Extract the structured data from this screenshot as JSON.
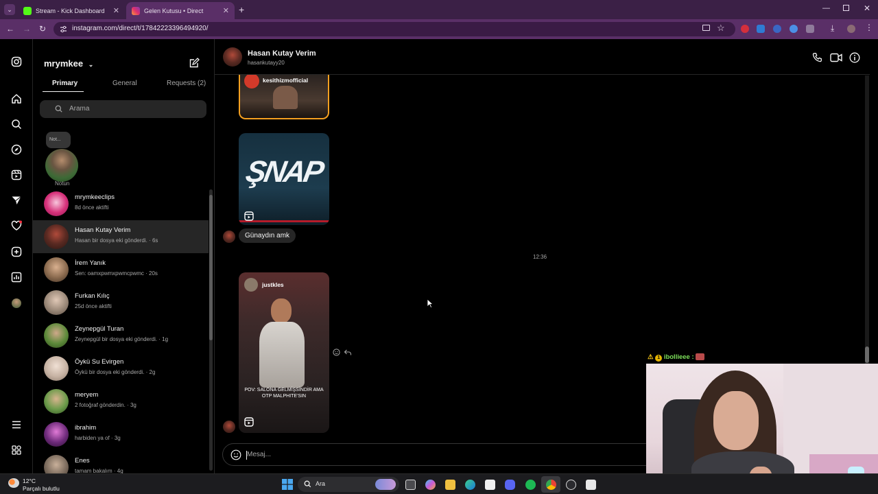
{
  "browser": {
    "tabs": [
      {
        "title": "Stream - Kick Dashboard",
        "active": false,
        "favicon_color": "#53fc18"
      },
      {
        "title": "Gelen Kutusu • Direct",
        "active": true,
        "favicon_color": "#e1306c"
      }
    ],
    "url": "instagram.com/direct/t/17842223396494920/"
  },
  "sidebar": {
    "account_name": "mrymkee",
    "tabs": [
      "Primary",
      "General",
      "Requests (2)"
    ],
    "search_placeholder": "Arama",
    "note": {
      "bubble": "Not...",
      "label": "Notun"
    },
    "conversations": [
      {
        "name": "mrymkeeclips",
        "sub": "8d önce aktifti",
        "color": "#d6317a"
      },
      {
        "name": "Hasan Kutay Verim",
        "sub": "Hasan bir dosya eki gönderdi. · 6s",
        "color": "#5a2a22",
        "selected": true
      },
      {
        "name": "İrem Yanık",
        "sub": "Sen: oamxpwmxpwmcpwmc · 20s",
        "color": "#8a6a4e"
      },
      {
        "name": "Furkan Kılıç",
        "sub": "25d önce aktifti",
        "color": "#9a8878"
      },
      {
        "name": "Zeynepgül Turan",
        "sub": "Zeynepgül bir dosya eki gönderdi. · 1g",
        "color": "#5d8a3a"
      },
      {
        "name": "Öykü Su Evirgen",
        "sub": "Öykü bir dosya eki gönderdi. · 2g",
        "color": "#c6b2a3"
      },
      {
        "name": "meryem",
        "sub": "2 fotoğraf gönderdin. · 3g",
        "color": "#6b9a4a"
      },
      {
        "name": "ibrahim",
        "sub": "harbiden ya of · 3g",
        "color": "#6d2a7a"
      },
      {
        "name": "Enes",
        "sub": "tamam bakalım · 4g",
        "color": "#7a6a5c"
      }
    ]
  },
  "chat": {
    "header_name": "Hasan Kutay Verim",
    "header_username": "hasankutayy20",
    "reel1_account": "kesithizmofficial",
    "reel2_text": "ŞNAP",
    "message": "Günaydın amk",
    "timestamp": "12:36",
    "reel3_account": "justkles",
    "reel3_caption": "POV: SALONA GELMİŞSİNDİR AMA OTP MALPHITE'SIN",
    "input_placeholder": "Mesaj..."
  },
  "overlay": {
    "chat_user": "ibollieee :"
  },
  "taskbar": {
    "weather_temp": "12°C",
    "weather_desc": "Parçalı bulutlu",
    "search_label": "Ara"
  }
}
